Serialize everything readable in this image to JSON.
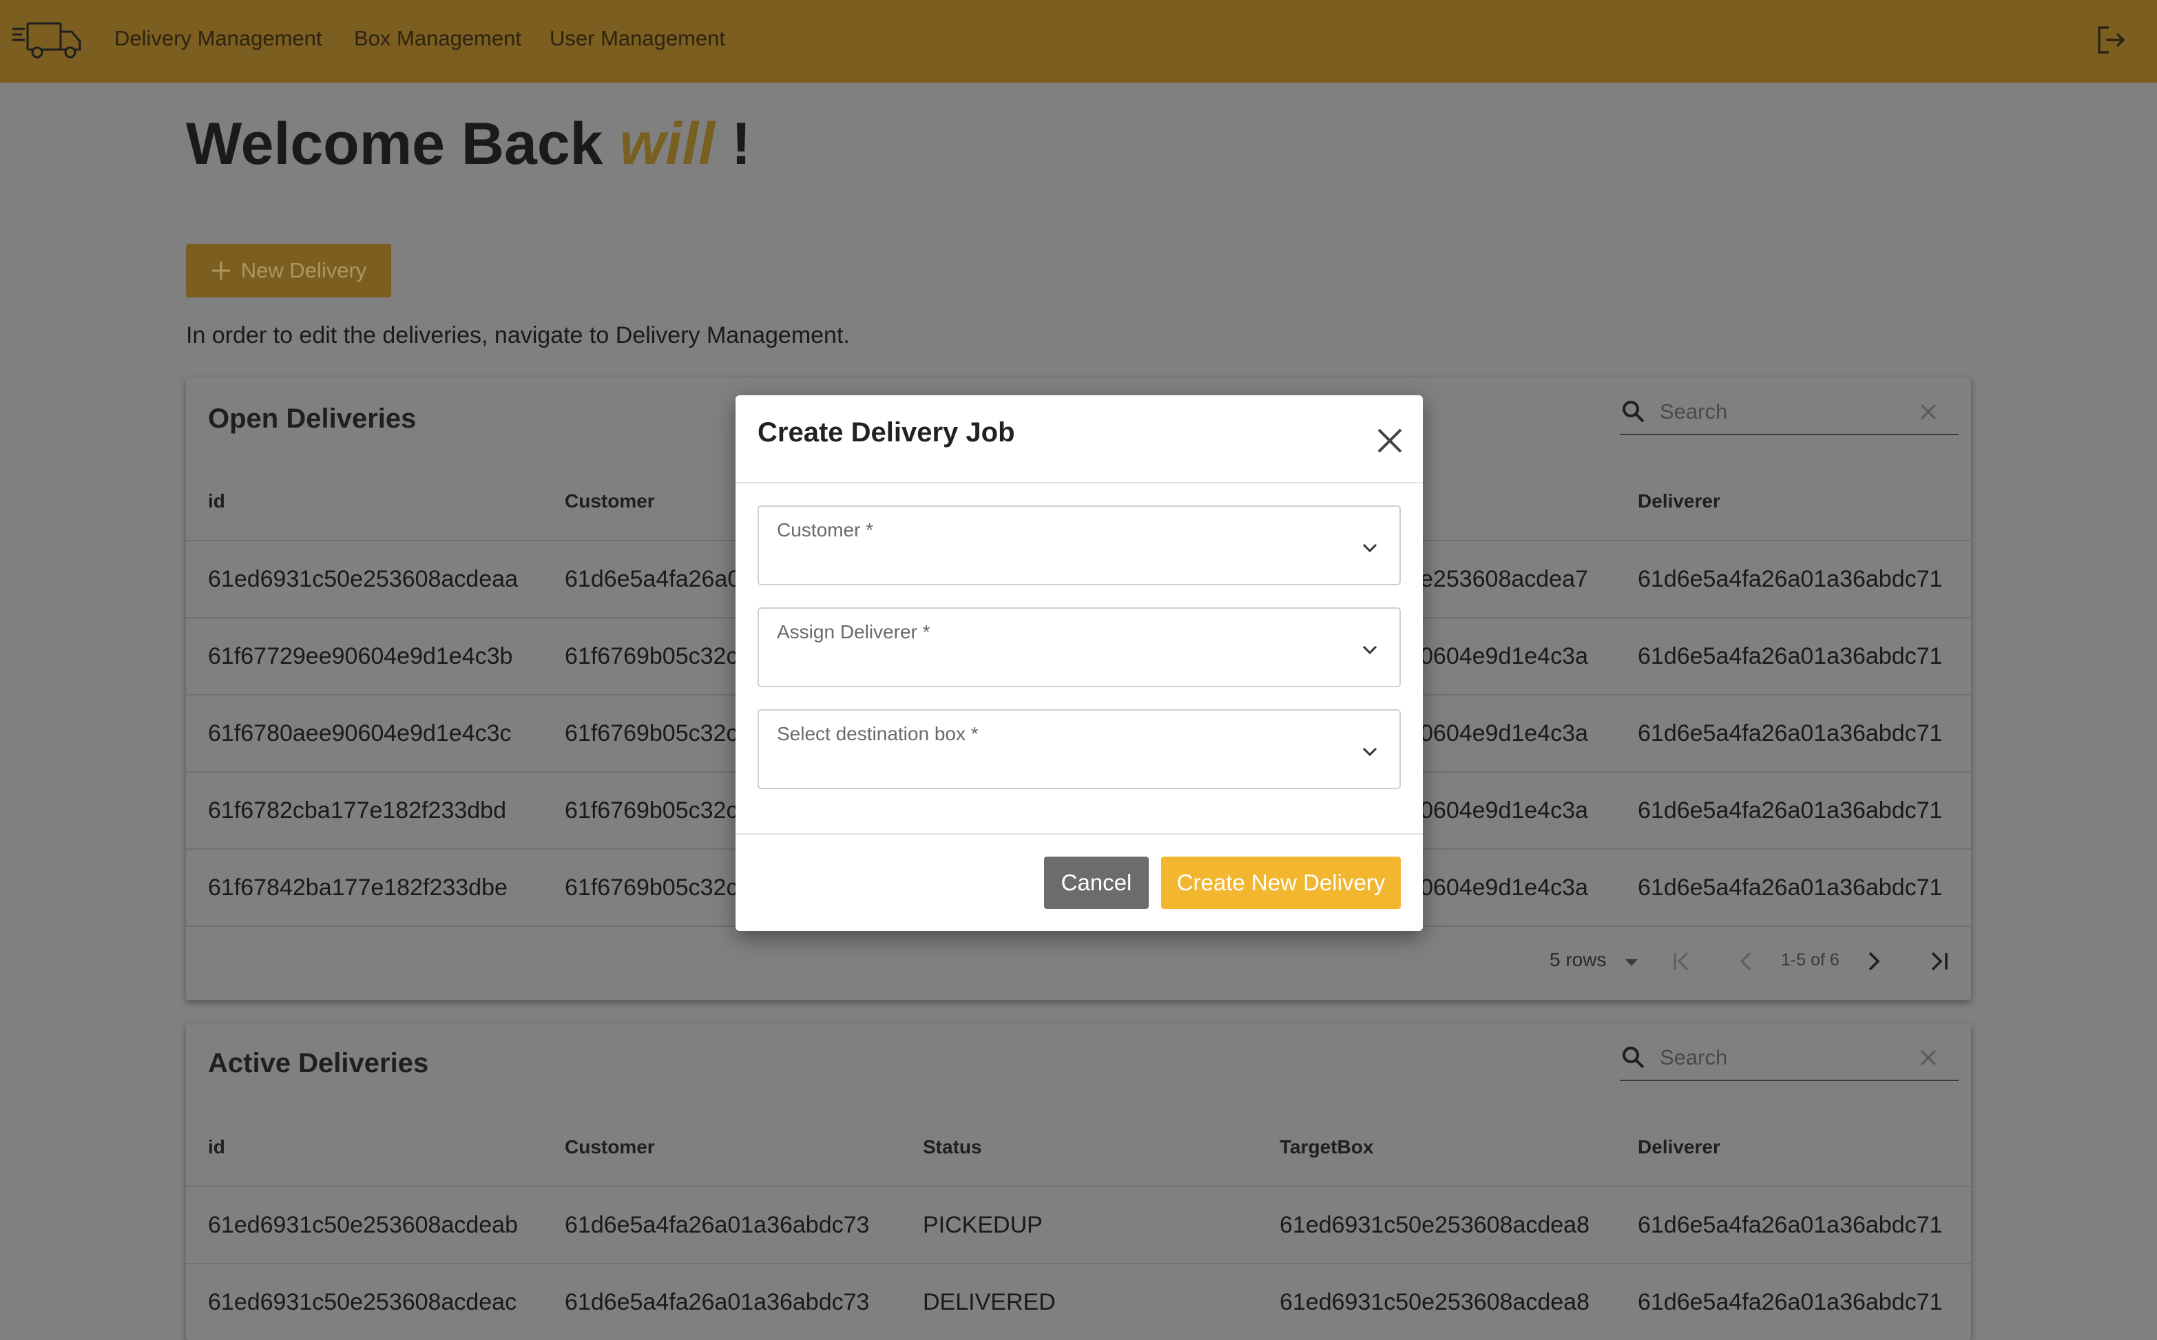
{
  "nav": {
    "logo_icon": "truck-icon",
    "links": [
      "Delivery Management",
      "Box Management",
      "User Management"
    ],
    "logout_icon": "logout-icon"
  },
  "welcome": {
    "prefix": "Welcome Back",
    "user": "will",
    "suffix": "!"
  },
  "new_delivery_button": "New Delivery",
  "hint": "In order to edit the deliveries, navigate to Delivery Management.",
  "open_deliveries": {
    "title": "Open Deliveries",
    "search_placeholder": "Search",
    "columns": [
      "id",
      "Customer",
      "Deliverer"
    ],
    "rows": [
      [
        "61ed6931c50e253608acdeaa",
        "61d6e5a4fa26a0",
        "e253608acdea7",
        "61d6e5a4fa26a01a36abdc71"
      ],
      [
        "61f67729ee90604e9d1e4c3b",
        "61f6769b05c32c",
        "0604e9d1e4c3a",
        "61d6e5a4fa26a01a36abdc71"
      ],
      [
        "61f6780aee90604e9d1e4c3c",
        "61f6769b05c32c",
        "0604e9d1e4c3a",
        "61d6e5a4fa26a01a36abdc71"
      ],
      [
        "61f6782cba177e182f233dbd",
        "61f6769b05c32c",
        "0604e9d1e4c3a",
        "61d6e5a4fa26a01a36abdc71"
      ],
      [
        "61f67842ba177e182f233dbe",
        "61f6769b05c32c",
        "0604e9d1e4c3a",
        "61d6e5a4fa26a01a36abdc71"
      ]
    ],
    "pagination": {
      "rows_label": "5 rows",
      "range": "1-5 of 6"
    }
  },
  "active_deliveries": {
    "title": "Active Deliveries",
    "search_placeholder": "Search",
    "columns": [
      "id",
      "Customer",
      "Status",
      "TargetBox",
      "Deliverer"
    ],
    "rows": [
      [
        "61ed6931c50e253608acdeab",
        "61d6e5a4fa26a01a36abdc73",
        "PICKEDUP",
        "61ed6931c50e253608acdea8",
        "61d6e5a4fa26a01a36abdc71"
      ],
      [
        "61ed6931c50e253608acdeac",
        "61d6e5a4fa26a01a36abdc73",
        "DELIVERED",
        "61ed6931c50e253608acdea8",
        "61d6e5a4fa26a01a36abdc71"
      ]
    ]
  },
  "modal": {
    "title": "Create Delivery Job",
    "fields": [
      "Customer *",
      "Assign Deliverer *",
      "Select destination box *"
    ],
    "cancel": "Cancel",
    "submit": "Create New Delivery"
  },
  "colors": {
    "navbar": "#7c5e20",
    "overlay_bg": "#808080",
    "accent_button": "#f2b62f",
    "cancel_button": "#6c6c6c"
  }
}
